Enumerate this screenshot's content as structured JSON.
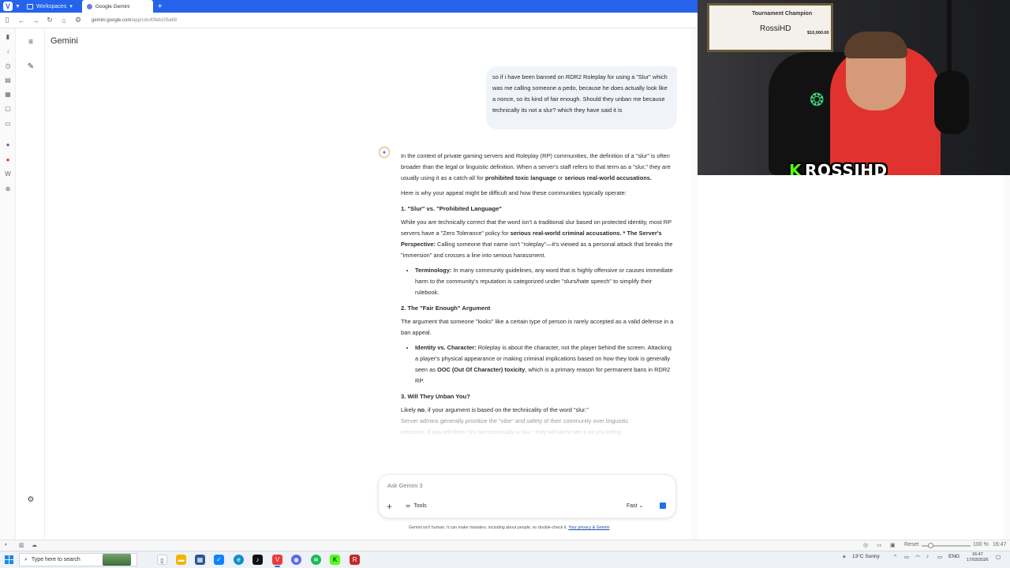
{
  "browser": {
    "workspaces_label": "Workspaces",
    "tab_title": "Google Gemini",
    "url_host": "gemini.google.com",
    "url_path": "/app/cdc40feb105a68"
  },
  "gemini": {
    "title": "Gemini",
    "user_message": "so if i have been banned on RDR2 Roleplay for using a \"Slur\" which was me calling someone a pedo, because he does actually look like a nonce, so its kind of fair enough. Should they unban me because technically its not a slur? which they have said it is",
    "response": {
      "intro_a": "In the context of private gaming servers and Roleplay (RP) communities, the definition of a \"slur\" is often broader than the legal or linguistic definition. When a server's staff refers to that term as a \"slur,\" they are usually using it as a catch-all for ",
      "intro_b1": "prohibited toxic language",
      "intro_c": " or ",
      "intro_b2": "serious real-world accusations.",
      "why": "Here is why your appeal might be difficult and how these communities typically operate:",
      "h1": "1. \"Slur\" vs. \"Prohibited Language\"",
      "s1_a": "While you are technically correct that the word isn't a traditional slur based on protected identity, most RP servers have a \"Zero Tolerance\" policy for ",
      "s1_b": "serious real-world criminal accusations. * The Server's Perspective:",
      "s1_c": " Calling someone that name isn't \"roleplay\"—it's viewed as a personal attack that breaks the \"immersion\" and crosses a line into serious harassment.",
      "b1_label": "Terminology:",
      "b1_text": " In many community guidelines, any word that is highly offensive or causes immediate harm to the community's reputation is categorized under \"slurs/hate speech\" to simplify their rulebook.",
      "h2": "2. The \"Fair Enough\" Argument",
      "s2": "The argument that someone \"looks\" like a certain type of person is rarely accepted as a valid defense in a ban appeal.",
      "b2_label": "Identity vs. Character:",
      "b2_text_a": " Roleplay is about the character, not the player behind the screen. Attacking a player's physical appearance or making criminal implications based on how they look is generally seen as ",
      "b2_bold": "OOC (Out Of Character) toxicity",
      "b2_text_b": ", which is a primary reason for permanent bans in RDR2 RP.",
      "h3": "3. Will They Unban You?",
      "s3_a": "Likely ",
      "s3_no": "no",
      "s3_b": ", if your argument is based on the technicality of the word \"slur.\"",
      "s3_fade": "Server admins generally prioritize the \"vibe\" and safety of their community over linguistic",
      "s3_fade2": "precision. If you tell them \"it's not technically a slur,\" they will likely see it as you being"
    },
    "input": {
      "placeholder": "Ask Gemini 3",
      "tools_label": "Tools",
      "mode_label": "Fast"
    },
    "disclaimer": "Gemini isn't human. It can make mistakes, including about people, so double-check it. ",
    "disclaimer_link": "Your privacy & Gemini"
  },
  "webcam": {
    "overlay_name": "ROSSIHD",
    "plaque_title": "Tournament Champion",
    "plaque_name": "RossiHD",
    "plaque_amount": "$10,000.00"
  },
  "statusbar": {
    "reset_label": "Reset",
    "zoom_level": "100 %",
    "time": "16:47"
  },
  "taskbar": {
    "search_placeholder": "Type here to search",
    "weather": "13°C  Sunny",
    "language": "ENG",
    "clock_time": "16:47",
    "clock_date": "17/03/2026"
  },
  "colors": {
    "accent": "#2563eb",
    "gemini_blue": "#1a73e8",
    "bubble": "#f0f4f9",
    "kick_green": "#53fc18"
  }
}
